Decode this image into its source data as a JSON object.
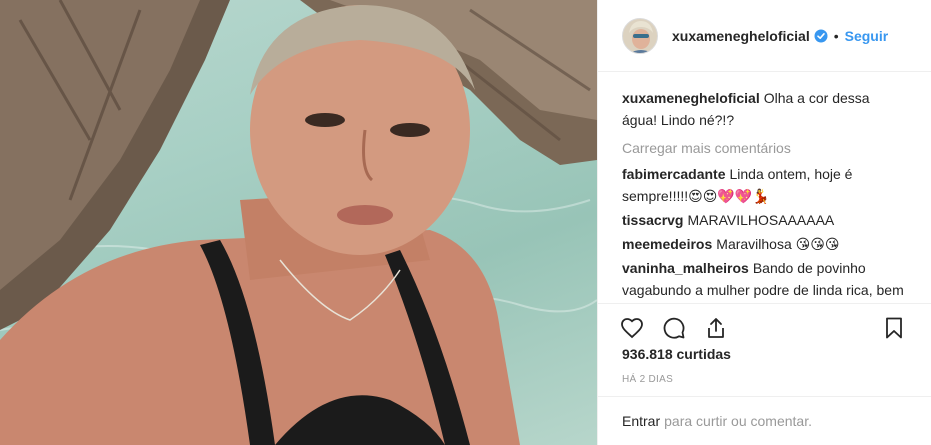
{
  "post": {
    "photo_alt": "",
    "header": {
      "username": "xuxamenegheloficial",
      "separator": "•",
      "follow_label": "Seguir"
    },
    "caption": {
      "author": "xuxamenegheloficial",
      "text": "Olha a cor dessa água! Lindo né?!?"
    },
    "load_more_label": "Carregar mais comentários",
    "comments": [
      {
        "author": "fabimercadante",
        "text": "Linda ontem, hoje é sempre!!!!!😍😍💖💖💃"
      },
      {
        "author": "tissacrvg",
        "text": "MARAVILHOSAAAAAA"
      },
      {
        "author": "meemedeiros",
        "text": "Maravilhosa 😘😘😘"
      },
      {
        "author": "vaninha_malheiros",
        "text": "Bando de povinho vagabundo a mulher podre de linda rica, bem resolvida ! Ivenja mata vão procurar"
      }
    ],
    "likes_text": "936.818 curtidas",
    "time_text": "HÁ 2 DIAS",
    "add_comment": {
      "login_label": "Entrar",
      "rest_text": "para curtir ou comentar."
    },
    "icons": {
      "like": "heart-icon",
      "comment": "comment-bubble-icon",
      "share": "share-icon",
      "save": "bookmark-icon",
      "verified": "verified-badge-icon"
    },
    "colors": {
      "link_blue": "#3897f0",
      "muted_gray": "#999999",
      "text_dark": "#262626"
    }
  }
}
